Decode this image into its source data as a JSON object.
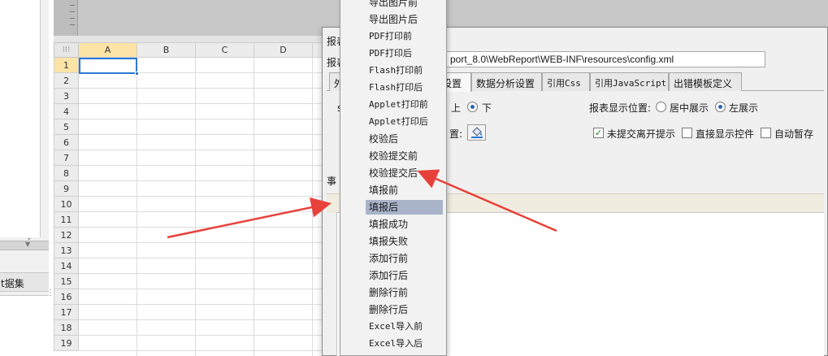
{
  "colors": {
    "accent_blue": "#2c78d4",
    "header_highlight": "#fce3a6",
    "menu_selected": "#a9b4ca",
    "annotation_red": "#e8413a"
  },
  "left_panel": {
    "tab_label": "数据集",
    "tab_label_partial": "t据集",
    "icons": [
      "chevron-down-icon",
      "grip-icon"
    ]
  },
  "sheet": {
    "corner_icon": "grid-dots-icon",
    "columns": [
      "A",
      "B",
      "C",
      "D"
    ],
    "rows": [
      "1",
      "2",
      "3",
      "4",
      "5",
      "6",
      "7",
      "8",
      "9",
      "10",
      "11",
      "12",
      "13",
      "14",
      "15",
      "16",
      "17",
      "18",
      "19"
    ],
    "active_cell": "A1"
  },
  "dialog": {
    "title": "报表",
    "path_label": "报表",
    "path_value": "port_8.0\\WebReport\\WEB-INF\\resources\\config.xml",
    "tabs": [
      "外",
      "设置",
      "数据分析设置",
      "引用Css",
      "引用JavaScript",
      "出错模板定义"
    ],
    "active_tab": 1,
    "row1_label_left": "s",
    "row1_option_up": "上",
    "row1_option_down": "下",
    "display_position_label": "报表显示位置:",
    "display_center": "居中展示",
    "display_left": "左展示",
    "row2_label_left": "置:",
    "checkboxes": [
      {
        "label": "未提交离开提示",
        "checked": true
      },
      {
        "label": "直接显示控件",
        "checked": false
      },
      {
        "label": "自动暂存",
        "checked": false
      }
    ],
    "side_letter": "事"
  },
  "menu": {
    "items": [
      "导出图片前",
      "导出图片后",
      "PDF打印前",
      "PDF打印后",
      "Flash打印前",
      "Flash打印后",
      "Applet打印前",
      "Applet打印后",
      "校验后",
      "校验提交前",
      "校验提交后",
      "填报前",
      "填报后",
      "填报成功",
      "填报失败",
      "添加行前",
      "添加行后",
      "删除行前",
      "删除行后",
      "Excel导入前",
      "Excel导入后"
    ],
    "selected_index": 12
  }
}
